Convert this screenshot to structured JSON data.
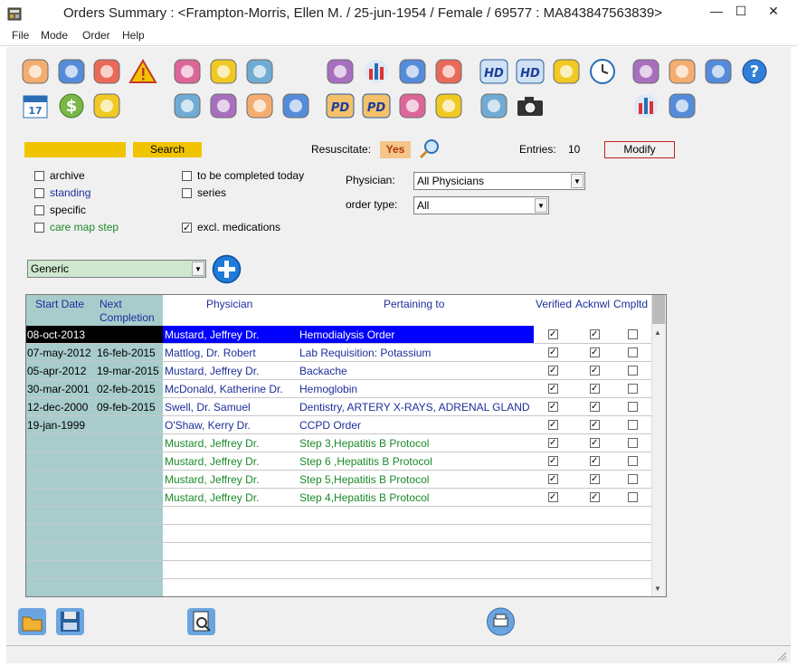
{
  "window": {
    "title": "Orders Summary :   <Frampton-Morris, Ellen M. / 25-jun-1954 / Female / 69577 : MA843847563839>",
    "minimize": "—",
    "maximize": "☐",
    "close": "✕"
  },
  "menu": [
    "File",
    "Mode",
    "Order",
    "Help"
  ],
  "toolbar_icons": [
    "patient-card-icon",
    "phone-icon",
    "house-icon",
    "warning-icon",
    "pills-icon",
    "stethoscope-icon",
    "handshake-icon",
    "report-icon",
    "bar-chart-icon",
    "printer-icon",
    "first-aid-kit-icon",
    "hd-icon",
    "hd-alt-icon",
    "hand-stop-icon",
    "clock-icon",
    "test-tubes-icon",
    "magnify-document-icon",
    "test-tubes-alt-icon",
    "help-icon",
    "calendar-icon",
    "dollar-icon",
    "contacts-book-icon",
    "puzzle-icon",
    "apple-icon",
    "flag-book-icon",
    "hospital-icon",
    "pd-icon",
    "pd-alt-icon",
    "body-front-icon",
    "body-female-icon",
    "group-icon",
    "camera-icon",
    "bar-chart-alt-icon",
    "zoom-lens-icon"
  ],
  "search": {
    "value": "",
    "button": "Search"
  },
  "resuscitate": {
    "label": "Resuscitate:",
    "value": "Yes"
  },
  "entries": {
    "label": "Entries:",
    "value": "10"
  },
  "modify_button": "Modify",
  "filters": {
    "archive": {
      "label": "archive",
      "checked": false
    },
    "standing": {
      "label": "standing",
      "checked": false
    },
    "specific": {
      "label": "specific",
      "checked": false
    },
    "care_map_step": {
      "label": "care map step",
      "checked": false
    },
    "to_be_completed_today": {
      "label": "to be completed today",
      "checked": false
    },
    "series": {
      "label": "series",
      "checked": false
    },
    "excl_medications": {
      "label": "excl. medications",
      "checked": true
    }
  },
  "physician_filter": {
    "label": "Physician:",
    "value": "All Physicians"
  },
  "order_type_filter": {
    "label": "order type:",
    "value": "All"
  },
  "template_select": {
    "value": "Generic"
  },
  "grid": {
    "headers": {
      "start_date": "Start Date",
      "next_completion_1": "Next",
      "next_completion_2": "Completion",
      "physician": "Physician",
      "pertaining_to": "Pertaining to",
      "verified": "Verified",
      "acknowledged": "Acknwl",
      "completed": "Cmpltd"
    },
    "rows": [
      {
        "start": "08-oct-2013",
        "next": "",
        "physician": "Mustard, Jeffrey Dr.",
        "pertaining": "Hemodialysis Order",
        "verified": true,
        "ack": true,
        "done": false,
        "color": "#1c2f9a",
        "selected": true
      },
      {
        "start": "07-may-2012",
        "next": "16-feb-2015",
        "physician": "Mattlog, Dr. Robert",
        "pertaining": "Lab Requisition: Potassium",
        "verified": true,
        "ack": true,
        "done": false,
        "color": "#1c2f9a",
        "selected": false
      },
      {
        "start": "05-apr-2012",
        "next": "19-mar-2015",
        "physician": "Mustard, Jeffrey Dr.",
        "pertaining": "Backache",
        "verified": true,
        "ack": true,
        "done": false,
        "color": "#1c2f9a",
        "selected": false
      },
      {
        "start": "30-mar-2001",
        "next": "02-feb-2015",
        "physician": "McDonald, Katherine Dr.",
        "pertaining": "Hemoglobin",
        "verified": true,
        "ack": true,
        "done": false,
        "color": "#1c2f9a",
        "selected": false
      },
      {
        "start": "12-dec-2000",
        "next": "09-feb-2015",
        "physician": "Swell, Dr. Samuel",
        "pertaining": "Dentistry, ARTERY X-RAYS, ADRENAL GLAND",
        "verified": true,
        "ack": true,
        "done": false,
        "color": "#1c2f9a",
        "selected": false
      },
      {
        "start": "19-jan-1999",
        "next": "",
        "physician": "O'Shaw, Kerry Dr.",
        "pertaining": "CCPD Order",
        "verified": true,
        "ack": true,
        "done": false,
        "color": "#1c2f9a",
        "selected": false
      },
      {
        "start": "",
        "next": "",
        "physician": "Mustard, Jeffrey Dr.",
        "pertaining": "Step 3,Hepatitis B Protocol",
        "verified": true,
        "ack": true,
        "done": false,
        "color": "#1b8a2a",
        "selected": false
      },
      {
        "start": "",
        "next": "",
        "physician": "Mustard, Jeffrey Dr.",
        "pertaining": "Step 6    ,Hepatitis B Protocol",
        "verified": true,
        "ack": true,
        "done": false,
        "color": "#1b8a2a",
        "selected": false
      },
      {
        "start": "",
        "next": "",
        "physician": "Mustard, Jeffrey Dr.",
        "pertaining": "Step 5,Hepatitis B Protocol",
        "verified": true,
        "ack": true,
        "done": false,
        "color": "#1b8a2a",
        "selected": false
      },
      {
        "start": "",
        "next": "",
        "physician": "Mustard, Jeffrey Dr.",
        "pertaining": "Step 4,Hepatitis B Protocol",
        "verified": true,
        "ack": true,
        "done": false,
        "color": "#1b8a2a",
        "selected": false
      }
    ]
  },
  "bottom_icons": [
    "open-folder-icon",
    "save-disk-icon",
    "preview-icon",
    "print-circle-icon"
  ]
}
